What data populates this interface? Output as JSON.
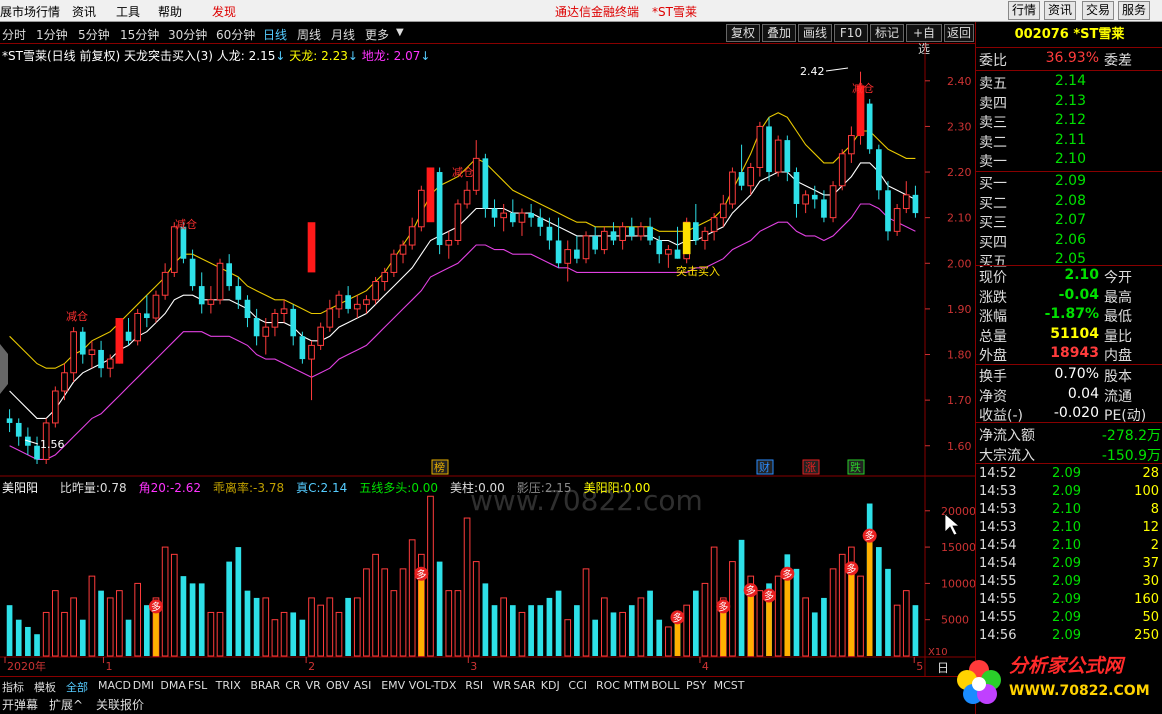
{
  "menu": {
    "items": [
      "展市场行情",
      "资讯",
      "工具",
      "帮助",
      "发现"
    ],
    "center_title": "通达信金融终端",
    "stock_name_title": "*ST雪莱",
    "right_buttons": [
      "行情",
      "资讯",
      "交易",
      "服务"
    ]
  },
  "periods": [
    "分时",
    "1分钟",
    "5分钟",
    "15分钟",
    "30分钟",
    "60分钟",
    "日线",
    "周线",
    "月线",
    "更多"
  ],
  "toolbar": [
    "复权",
    "叠加",
    "画线",
    "F10",
    "标记",
    "+自选",
    "返回"
  ],
  "indicator_line": {
    "name": "*ST雪莱(日线 前复权) 天龙突击买入(3)",
    "renlong_label": "人龙:",
    "renlong_value": "2.15",
    "tianlong_label": "天龙:",
    "tianlong_value": "2.23",
    "dilong_label": "地龙:",
    "dilong_value": "2.07"
  },
  "volume_legend": {
    "name": "美阳阳",
    "items": [
      {
        "label": "比昨量:",
        "value": "0.78",
        "color": "#dddddd"
      },
      {
        "label": "角20:",
        "value": "-2.62",
        "color": "#f3f"
      },
      {
        "label": "乖离率:",
        "value": "-3.78",
        "color": "#c0a000"
      },
      {
        "label": "真C:",
        "value": "2.14",
        "color": "#5cf"
      },
      {
        "label": "五线多头:",
        "value": "0.00",
        "color": "#00e000"
      },
      {
        "label": "美柱:",
        "value": "0.00",
        "color": "#dddddd"
      },
      {
        "label": "影压:",
        "value": "2.15",
        "color": "#888888"
      },
      {
        "label": "美阳阳:",
        "value": "0.00",
        "color": "#ff0"
      }
    ]
  },
  "price_axis": [
    "2.40",
    "2.30",
    "2.20",
    "2.10",
    "2.00",
    "1.90",
    "1.80",
    "1.70",
    "1.60"
  ],
  "volume_axis": [
    "20000",
    "15000",
    "10000",
    "5000"
  ],
  "volume_unit": "X10",
  "time_axis": [
    "2020年",
    "1",
    "2",
    "3",
    "4",
    "5"
  ],
  "annotations": {
    "high": "2.42",
    "low": "1.56",
    "signal_buy": "突击买入",
    "signal_reduce": "减仓",
    "marker_duo": "多",
    "tag_bang": "榜",
    "tag_cai": "财",
    "tag_zhang": "涨",
    "tag_die": "跌"
  },
  "quote": {
    "code_name": "002076 *ST雪莱",
    "weibi_label": "委比",
    "weibi_value": "36.93%",
    "weicha_label": "委差",
    "asks": [
      {
        "label": "卖五",
        "price": "2.14"
      },
      {
        "label": "卖四",
        "price": "2.13"
      },
      {
        "label": "卖三",
        "price": "2.12"
      },
      {
        "label": "卖二",
        "price": "2.11"
      },
      {
        "label": "卖一",
        "price": "2.10"
      }
    ],
    "bids": [
      {
        "label": "买一",
        "price": "2.09"
      },
      {
        "label": "买二",
        "price": "2.08"
      },
      {
        "label": "买三",
        "price": "2.07"
      },
      {
        "label": "买四",
        "price": "2.06"
      },
      {
        "label": "买五",
        "price": "2.05"
      }
    ],
    "stats": [
      {
        "label": "现价",
        "value": "2.10",
        "color": "#00e000",
        "label2": "今开"
      },
      {
        "label": "涨跌",
        "value": "-0.04",
        "color": "#00e000",
        "label2": "最高"
      },
      {
        "label": "涨幅",
        "value": "-1.87%",
        "color": "#00e000",
        "label2": "最低"
      },
      {
        "label": "总量",
        "value": "51104",
        "color": "#ff0",
        "label2": "量比"
      },
      {
        "label": "外盘",
        "value": "18943",
        "color": "#ff3c3c",
        "label2": "内盘"
      }
    ],
    "stats2": [
      {
        "label": "换手",
        "value": "0.70%",
        "label2": "股本"
      },
      {
        "label": "净资",
        "value": "0.04",
        "label2": "流通"
      },
      {
        "label": "收益(-)",
        "value": "-0.020",
        "label2": "PE(动)"
      }
    ],
    "flows": [
      {
        "label": "净流入额",
        "value": "-278.2万"
      },
      {
        "label": "大宗流入",
        "value": "-150.9万"
      }
    ],
    "ticks": [
      {
        "time": "14:52",
        "price": "2.09",
        "vol": "28"
      },
      {
        "time": "14:53",
        "price": "2.09",
        "vol": "100"
      },
      {
        "time": "14:53",
        "price": "2.10",
        "vol": "8"
      },
      {
        "time": "14:53",
        "price": "2.10",
        "vol": "12"
      },
      {
        "time": "14:54",
        "price": "2.10",
        "vol": "2"
      },
      {
        "time": "14:54",
        "price": "2.09",
        "vol": "37"
      },
      {
        "time": "14:55",
        "price": "2.09",
        "vol": "30"
      },
      {
        "time": "14:55",
        "price": "2.09",
        "vol": "160"
      },
      {
        "time": "14:55",
        "price": "2.09",
        "vol": "50"
      },
      {
        "time": "14:56",
        "price": "2.09",
        "vol": "250"
      }
    ]
  },
  "tabs": [
    "指标",
    "模板",
    "全部",
    "MACD",
    "DMI",
    "DMA",
    "FSL",
    "TRIX",
    "BRAR",
    "CR",
    "VR",
    "OBV",
    "ASI",
    "EMV",
    "VOL-TDX",
    "RSI",
    "WR",
    "SAR",
    "KDJ",
    "CCI",
    "ROC",
    "MTM",
    "BOLL",
    "PSY",
    "MCST"
  ],
  "bottom_tabs": [
    "开弹幕",
    "扩展^",
    "关联报价"
  ],
  "side_letter": "日",
  "watermark": "www.70822.com",
  "logo": {
    "title": "分析家公式网",
    "url": "WWW.70822.COM"
  },
  "colors": {
    "up": "#ff3c3c",
    "down": "#2ee0e8",
    "renlong": "#ffffff",
    "tianlong": "#e8c800",
    "dilong": "#e040e0"
  },
  "chart_data": {
    "type": "candlestick",
    "ylim": [
      1.56,
      2.45
    ],
    "candles": [
      [
        1.66,
        1.68,
        1.63,
        1.65
      ],
      [
        1.65,
        1.66,
        1.6,
        1.62
      ],
      [
        1.62,
        1.64,
        1.58,
        1.6
      ],
      [
        1.6,
        1.62,
        1.56,
        1.57
      ],
      [
        1.57,
        1.66,
        1.56,
        1.65
      ],
      [
        1.65,
        1.73,
        1.64,
        1.72
      ],
      [
        1.72,
        1.78,
        1.7,
        1.76
      ],
      [
        1.76,
        1.86,
        1.74,
        1.85
      ],
      [
        1.85,
        1.86,
        1.78,
        1.8
      ],
      [
        1.8,
        1.83,
        1.77,
        1.81
      ],
      [
        1.81,
        1.83,
        1.75,
        1.77
      ],
      [
        1.77,
        1.8,
        1.75,
        1.79
      ],
      [
        1.79,
        1.86,
        1.78,
        1.85
      ],
      [
        1.85,
        1.88,
        1.82,
        1.83
      ],
      [
        1.83,
        1.9,
        1.82,
        1.89
      ],
      [
        1.89,
        1.93,
        1.86,
        1.88
      ],
      [
        1.88,
        1.94,
        1.87,
        1.93
      ],
      [
        1.93,
        2.0,
        1.92,
        1.98
      ],
      [
        1.98,
        2.09,
        1.97,
        2.08
      ],
      [
        2.08,
        2.09,
        2.0,
        2.01
      ],
      [
        2.01,
        2.03,
        1.94,
        1.95
      ],
      [
        1.95,
        1.98,
        1.89,
        1.91
      ],
      [
        1.91,
        1.95,
        1.89,
        1.92
      ],
      [
        1.92,
        2.01,
        1.91,
        2.0
      ],
      [
        2.0,
        2.02,
        1.94,
        1.95
      ],
      [
        1.95,
        1.97,
        1.9,
        1.92
      ],
      [
        1.92,
        1.93,
        1.86,
        1.88
      ],
      [
        1.88,
        1.9,
        1.82,
        1.84
      ],
      [
        1.84,
        1.88,
        1.8,
        1.86
      ],
      [
        1.86,
        1.9,
        1.84,
        1.89
      ],
      [
        1.89,
        1.92,
        1.87,
        1.9
      ],
      [
        1.9,
        1.91,
        1.82,
        1.84
      ],
      [
        1.84,
        1.85,
        1.78,
        1.79
      ],
      [
        1.79,
        1.83,
        1.7,
        1.82
      ],
      [
        1.82,
        1.87,
        1.81,
        1.86
      ],
      [
        1.86,
        1.92,
        1.85,
        1.9
      ],
      [
        1.9,
        1.94,
        1.88,
        1.93
      ],
      [
        1.93,
        1.95,
        1.89,
        1.9
      ],
      [
        1.9,
        1.93,
        1.88,
        1.91
      ],
      [
        1.91,
        1.93,
        1.89,
        1.92
      ],
      [
        1.92,
        1.97,
        1.91,
        1.96
      ],
      [
        1.96,
        1.99,
        1.94,
        1.98
      ],
      [
        1.98,
        2.03,
        1.97,
        2.02
      ],
      [
        2.02,
        2.05,
        2.0,
        2.04
      ],
      [
        2.04,
        2.1,
        2.03,
        2.08
      ],
      [
        2.08,
        2.17,
        2.07,
        2.16
      ],
      [
        2.16,
        2.21,
        2.15,
        2.2
      ],
      [
        2.2,
        2.21,
        2.02,
        2.04
      ],
      [
        2.04,
        2.07,
        2.01,
        2.05
      ],
      [
        2.05,
        2.14,
        2.04,
        2.13
      ],
      [
        2.13,
        2.18,
        2.12,
        2.16
      ],
      [
        2.16,
        2.27,
        2.15,
        2.23
      ],
      [
        2.23,
        2.24,
        2.1,
        2.12
      ],
      [
        2.12,
        2.14,
        2.08,
        2.1
      ],
      [
        2.1,
        2.13,
        2.07,
        2.11
      ],
      [
        2.11,
        2.14,
        2.08,
        2.09
      ],
      [
        2.09,
        2.12,
        2.06,
        2.11
      ],
      [
        2.11,
        2.13,
        2.08,
        2.1
      ],
      [
        2.1,
        2.12,
        2.06,
        2.08
      ],
      [
        2.08,
        2.1,
        2.03,
        2.05
      ],
      [
        2.05,
        2.1,
        1.99,
        2.0
      ],
      [
        2.0,
        2.05,
        1.96,
        2.03
      ],
      [
        2.03,
        2.06,
        2.0,
        2.01
      ],
      [
        2.01,
        2.07,
        2.0,
        2.06
      ],
      [
        2.06,
        2.08,
        2.02,
        2.03
      ],
      [
        2.03,
        2.08,
        2.02,
        2.07
      ],
      [
        2.07,
        2.09,
        2.04,
        2.05
      ],
      [
        2.05,
        2.09,
        2.03,
        2.08
      ],
      [
        2.08,
        2.1,
        2.05,
        2.06
      ],
      [
        2.06,
        2.09,
        2.05,
        2.08
      ],
      [
        2.08,
        2.1,
        2.04,
        2.05
      ],
      [
        2.05,
        2.06,
        2.0,
        2.02
      ],
      [
        2.02,
        2.04,
        1.99,
        2.03
      ],
      [
        2.03,
        2.08,
        2.01,
        2.01
      ],
      [
        2.01,
        2.1,
        2.0,
        2.09
      ],
      [
        2.09,
        2.13,
        2.04,
        2.05
      ],
      [
        2.05,
        2.08,
        2.03,
        2.07
      ],
      [
        2.07,
        2.11,
        2.05,
        2.1
      ],
      [
        2.1,
        2.15,
        2.08,
        2.13
      ],
      [
        2.13,
        2.21,
        2.12,
        2.2
      ],
      [
        2.2,
        2.26,
        2.16,
        2.17
      ],
      [
        2.17,
        2.22,
        2.15,
        2.21
      ],
      [
        2.21,
        2.31,
        2.19,
        2.3
      ],
      [
        2.3,
        2.32,
        2.18,
        2.2
      ],
      [
        2.2,
        2.28,
        2.19,
        2.27
      ],
      [
        2.27,
        2.28,
        2.18,
        2.2
      ],
      [
        2.2,
        2.21,
        2.1,
        2.13
      ],
      [
        2.13,
        2.16,
        2.11,
        2.15
      ],
      [
        2.15,
        2.17,
        2.12,
        2.14
      ],
      [
        2.14,
        2.16,
        2.09,
        2.1
      ],
      [
        2.1,
        2.18,
        2.09,
        2.17
      ],
      [
        2.17,
        2.25,
        2.16,
        2.24
      ],
      [
        2.24,
        2.3,
        2.22,
        2.28
      ],
      [
        2.28,
        2.42,
        2.26,
        2.35
      ],
      [
        2.35,
        2.36,
        2.24,
        2.25
      ],
      [
        2.25,
        2.26,
        2.14,
        2.16
      ],
      [
        2.16,
        2.18,
        2.05,
        2.07
      ],
      [
        2.07,
        2.13,
        2.06,
        2.12
      ],
      [
        2.12,
        2.18,
        2.11,
        2.15
      ],
      [
        2.15,
        2.17,
        2.1,
        2.11
      ]
    ],
    "renlong": [
      1.72,
      1.7,
      1.68,
      1.66,
      1.66,
      1.68,
      1.71,
      1.74,
      1.76,
      1.77,
      1.78,
      1.79,
      1.81,
      1.82,
      1.84,
      1.85,
      1.87,
      1.89,
      1.92,
      1.93,
      1.93,
      1.92,
      1.92,
      1.92,
      1.92,
      1.91,
      1.9,
      1.88,
      1.87,
      1.87,
      1.87,
      1.86,
      1.84,
      1.83,
      1.83,
      1.84,
      1.86,
      1.87,
      1.88,
      1.89,
      1.91,
      1.93,
      1.95,
      1.97,
      1.99,
      2.02,
      2.05,
      2.06,
      2.07,
      2.08,
      2.1,
      2.12,
      2.12,
      2.12,
      2.12,
      2.11,
      2.11,
      2.11,
      2.1,
      2.09,
      2.08,
      2.07,
      2.06,
      2.06,
      2.06,
      2.06,
      2.06,
      2.06,
      2.06,
      2.06,
      2.06,
      2.05,
      2.05,
      2.04,
      2.05,
      2.05,
      2.06,
      2.07,
      2.08,
      2.11,
      2.13,
      2.15,
      2.18,
      2.19,
      2.2,
      2.2,
      2.18,
      2.17,
      2.16,
      2.15,
      2.15,
      2.17,
      2.19,
      2.22,
      2.22,
      2.2,
      2.17,
      2.16,
      2.15,
      2.14
    ],
    "tianlong": [
      1.84,
      1.82,
      1.8,
      1.78,
      1.77,
      1.77,
      1.78,
      1.8,
      1.81,
      1.83,
      1.84,
      1.85,
      1.87,
      1.89,
      1.91,
      1.93,
      1.95,
      1.97,
      2.0,
      2.02,
      2.02,
      2.01,
      2.0,
      1.99,
      1.98,
      1.97,
      1.95,
      1.94,
      1.93,
      1.92,
      1.92,
      1.91,
      1.9,
      1.89,
      1.89,
      1.9,
      1.91,
      1.92,
      1.93,
      1.94,
      1.96,
      1.98,
      2.01,
      2.04,
      2.07,
      2.11,
      2.15,
      2.17,
      2.18,
      2.19,
      2.21,
      2.23,
      2.22,
      2.2,
      2.18,
      2.16,
      2.15,
      2.14,
      2.13,
      2.12,
      2.11,
      2.1,
      2.09,
      2.09,
      2.08,
      2.08,
      2.08,
      2.08,
      2.08,
      2.08,
      2.08,
      2.07,
      2.07,
      2.07,
      2.07,
      2.08,
      2.09,
      2.1,
      2.12,
      2.16,
      2.2,
      2.24,
      2.29,
      2.32,
      2.33,
      2.32,
      2.29,
      2.26,
      2.24,
      2.22,
      2.22,
      2.24,
      2.26,
      2.29,
      2.29,
      2.27,
      2.25,
      2.24,
      2.23,
      2.23
    ],
    "dilong": [
      1.6,
      1.59,
      1.58,
      1.57,
      1.57,
      1.58,
      1.6,
      1.62,
      1.64,
      1.66,
      1.67,
      1.69,
      1.71,
      1.73,
      1.75,
      1.77,
      1.79,
      1.81,
      1.83,
      1.85,
      1.85,
      1.85,
      1.84,
      1.84,
      1.84,
      1.83,
      1.82,
      1.8,
      1.79,
      1.79,
      1.78,
      1.77,
      1.76,
      1.75,
      1.76,
      1.77,
      1.79,
      1.8,
      1.81,
      1.82,
      1.84,
      1.86,
      1.88,
      1.9,
      1.92,
      1.94,
      1.97,
      1.98,
      1.99,
      2.0,
      2.02,
      2.04,
      2.04,
      2.03,
      2.03,
      2.02,
      2.02,
      2.02,
      2.01,
      2.0,
      1.99,
      1.99,
      1.98,
      1.98,
      1.98,
      1.98,
      1.98,
      1.98,
      1.98,
      1.98,
      1.98,
      1.98,
      1.98,
      1.98,
      1.98,
      1.99,
      1.99,
      2.0,
      2.01,
      2.03,
      2.04,
      2.05,
      2.07,
      2.08,
      2.09,
      2.09,
      2.07,
      2.06,
      2.06,
      2.05,
      2.06,
      2.08,
      2.1,
      2.13,
      2.13,
      2.12,
      2.1,
      2.09,
      2.08,
      2.07
    ],
    "volume": [
      7,
      5,
      4,
      3,
      6,
      9,
      6,
      8,
      5,
      11,
      9,
      8,
      9,
      5,
      10,
      7,
      8,
      15,
      14,
      11,
      10,
      10,
      6,
      6,
      13,
      15,
      9,
      8,
      8,
      5,
      6,
      6,
      5,
      8,
      7,
      8,
      6,
      8,
      8,
      12,
      14,
      12,
      9,
      12,
      16,
      14,
      22,
      13,
      9,
      9,
      19,
      13,
      10,
      7,
      8,
      7,
      6,
      7,
      7,
      8,
      9,
      5,
      7,
      12,
      5,
      8,
      6,
      6,
      7,
      8,
      9,
      5,
      4,
      6,
      7,
      9,
      10,
      15,
      8,
      13,
      16,
      11,
      9,
      10,
      11,
      14,
      12,
      8,
      6,
      8,
      12,
      14,
      15,
      11,
      21,
      15,
      12,
      7,
      9,
      7
    ],
    "vol_ylim": [
      0,
      23000
    ]
  }
}
